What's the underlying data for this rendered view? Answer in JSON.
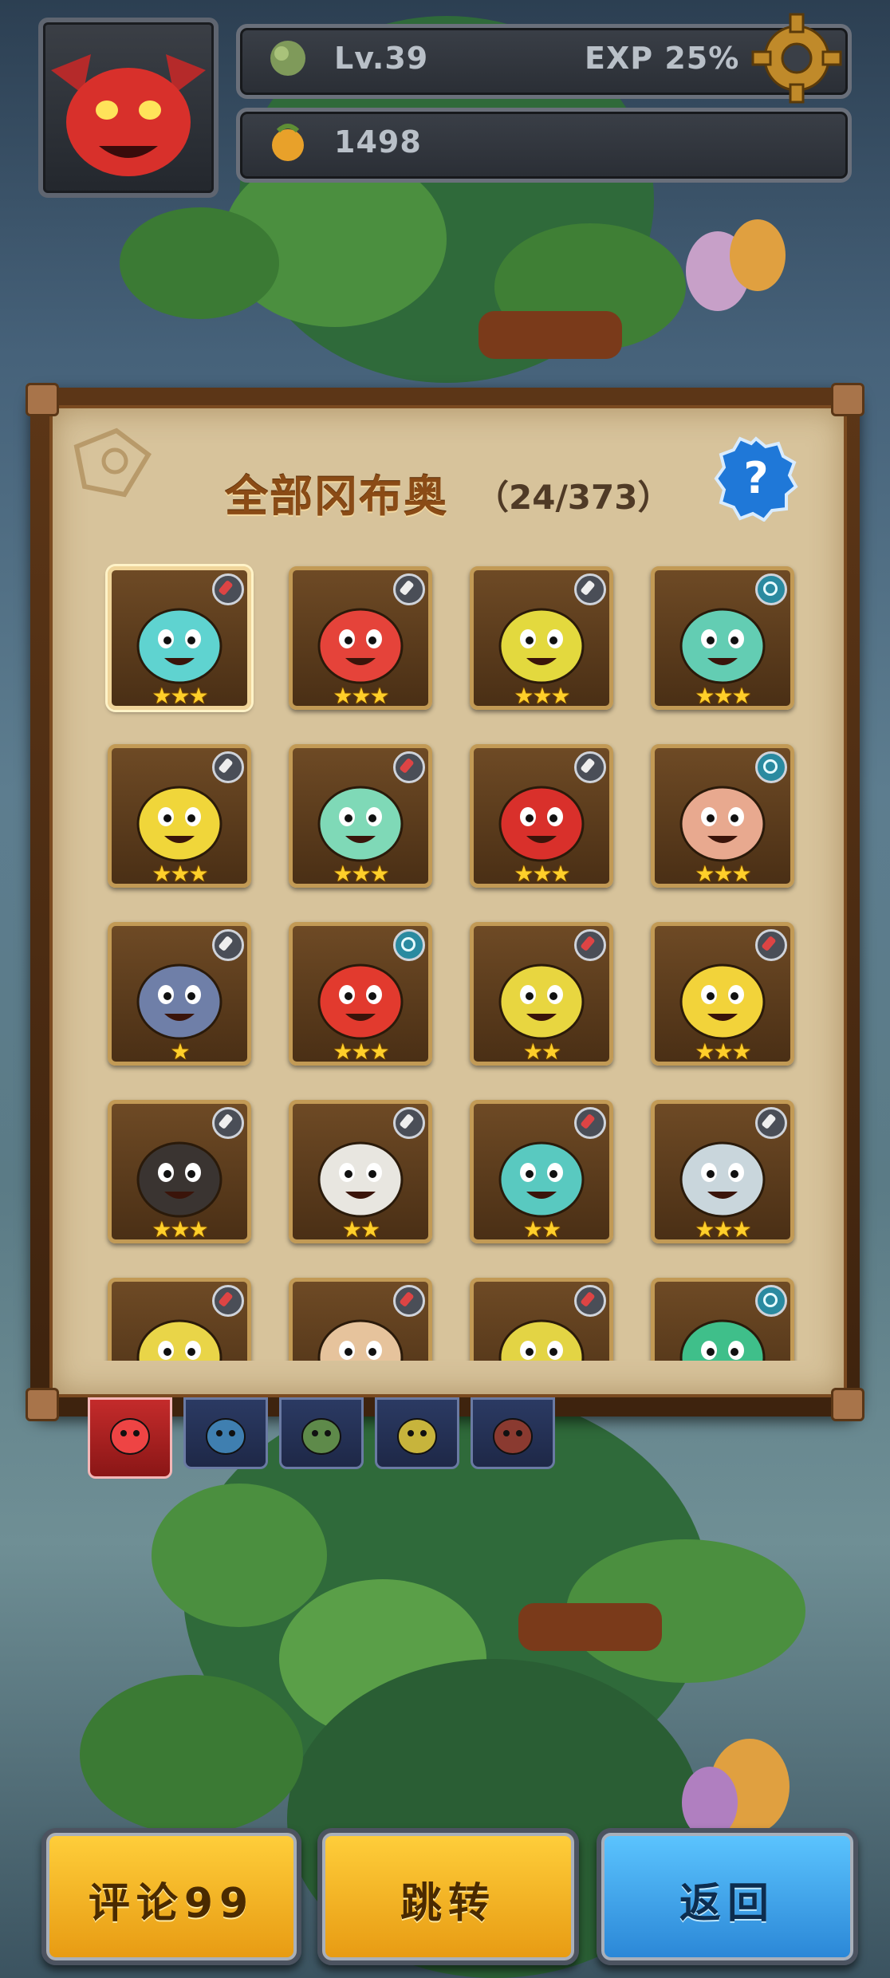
{
  "hud": {
    "level_label": "Lv.39",
    "exp_label": "EXP 25%",
    "coins": "1498"
  },
  "collection": {
    "title": "全部冈布奥",
    "count": "（24/373）",
    "help_label": "?"
  },
  "cards": [
    {
      "color": "#5fd3d0",
      "badge": "red",
      "stars": "★★★",
      "selected": true
    },
    {
      "color": "#e5433a",
      "badge": "sword",
      "stars": "★★★"
    },
    {
      "color": "#e3d93e",
      "badge": "sword",
      "stars": "★★★"
    },
    {
      "color": "#63cdb3",
      "badge": "spiral",
      "stars": "★★★"
    },
    {
      "color": "#f0d63a",
      "badge": "sword",
      "stars": "★★★"
    },
    {
      "color": "#7fd9b7",
      "badge": "red",
      "stars": "★★★"
    },
    {
      "color": "#d9302b",
      "badge": "sword",
      "stars": "★★★"
    },
    {
      "color": "#e8a98f",
      "badge": "spiral",
      "stars": "★★★"
    },
    {
      "color": "#6f7fa8",
      "badge": "sword",
      "stars": "★"
    },
    {
      "color": "#e23a2e",
      "badge": "spiral",
      "stars": "★★★"
    },
    {
      "color": "#e8d640",
      "badge": "red",
      "stars": "★★"
    },
    {
      "color": "#f2d33a",
      "badge": "red",
      "stars": "★★★"
    },
    {
      "color": "#3a3431",
      "badge": "sword",
      "stars": "★★★"
    },
    {
      "color": "#e8e6e0",
      "badge": "sword",
      "stars": "★★"
    },
    {
      "color": "#59c9c0",
      "badge": "red",
      "stars": "★★"
    },
    {
      "color": "#c9d6dc",
      "badge": "sword",
      "stars": "★★★"
    },
    {
      "color": "#e9d548",
      "badge": "red",
      "stars": ""
    },
    {
      "color": "#e6c39c",
      "badge": "red",
      "stars": ""
    },
    {
      "color": "#e3d444",
      "badge": "red",
      "stars": ""
    },
    {
      "color": "#3fbf8a",
      "badge": "spiral",
      "stars": ""
    }
  ],
  "tabs": [
    {
      "name": "all",
      "color": "#e44"
    },
    {
      "name": "blue",
      "color": "#3f7fb0"
    },
    {
      "name": "green",
      "color": "#5e8a4a"
    },
    {
      "name": "yellow",
      "color": "#c7b43c"
    },
    {
      "name": "red",
      "color": "#8a3a30"
    }
  ],
  "buttons": {
    "comment": "评论99",
    "jump": "跳转",
    "back": "返回"
  }
}
